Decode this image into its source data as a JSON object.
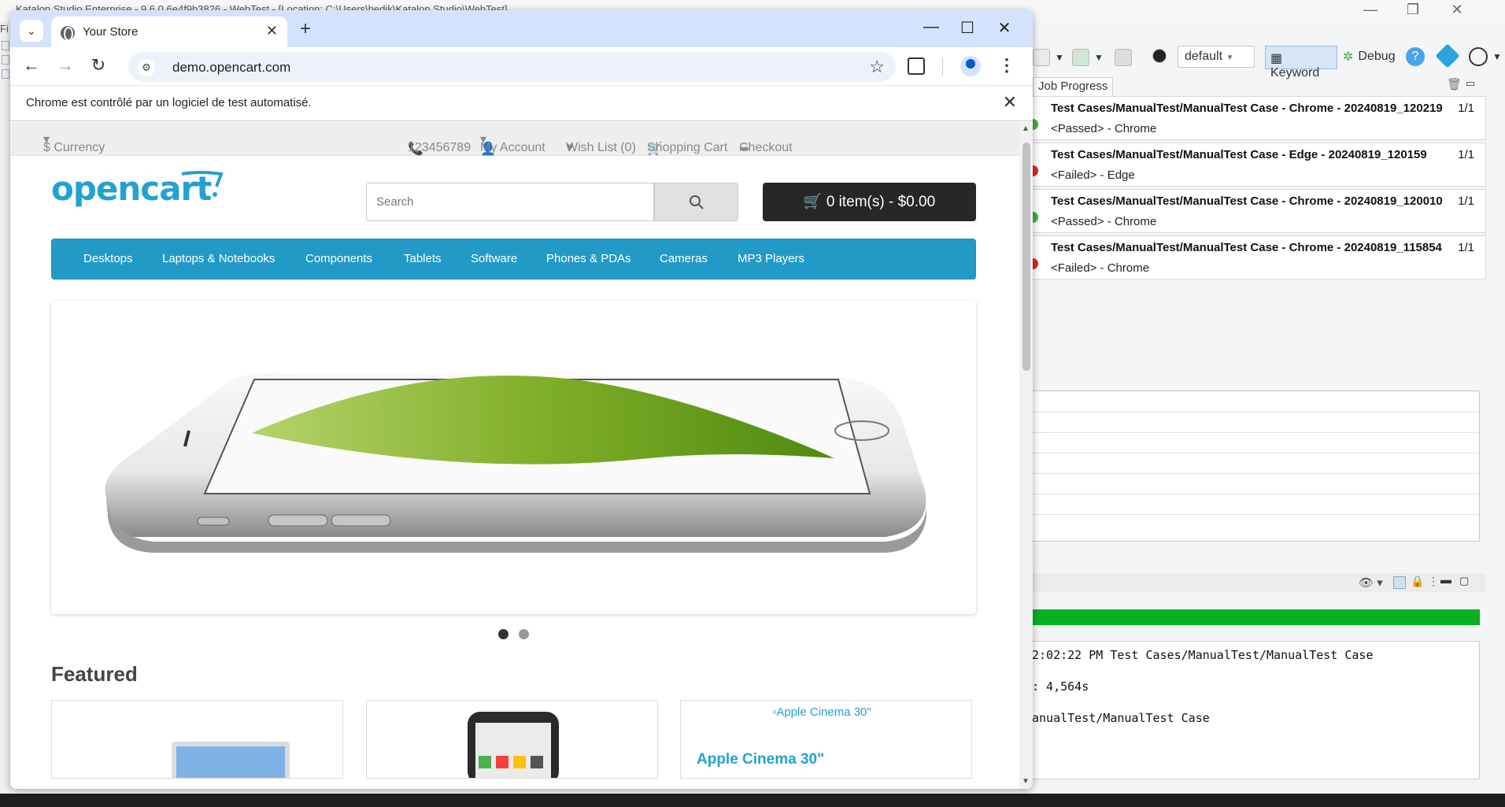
{
  "katalon": {
    "title": "Katalon Studio Enterprise - 9.6.0 6e4f9b3826 - WebTest - [Location: C:\\Users\\bedik\\Katalon Studio\\WebTest]",
    "menu_fragment": "Fi",
    "toolbar": {
      "profile": "default",
      "keyword_label": "Keyword",
      "debug_label": "Debug"
    },
    "job_progress_tab": "Job Progress",
    "jobs": [
      {
        "title": "Test Cases/ManualTest/ManualTest Case - Chrome - 20240819_120219",
        "count": "1/1",
        "status": "<Passed> - Chrome",
        "color": "#3bb33b"
      },
      {
        "title": "Test Cases/ManualTest/ManualTest Case - Edge - 20240819_120159",
        "count": "1/1",
        "status": "<Failed> - Edge",
        "color": "#e02424"
      },
      {
        "title": "Test Cases/ManualTest/ManualTest Case - Chrome - 20240819_120010",
        "count": "1/1",
        "status": "<Passed> - Chrome",
        "color": "#3bb33b"
      },
      {
        "title": "Test Cases/ManualTest/ManualTest Case - Chrome - 20240819_115854",
        "count": "1/1",
        "status": "<Failed> - Chrome",
        "color": "#e02424"
      }
    ],
    "progress": 1.0,
    "console_lines": [
      "2:02:22 PM Test Cases/ManualTest/ManualTest Case",
      ": 4,564s",
      "anualTest/ManualTest Case"
    ]
  },
  "chrome": {
    "tab_title": "Your Store",
    "url": "demo.opencart.com",
    "infobar_text": "Chrome est contrôlé par un logiciel de test automatisé."
  },
  "store": {
    "currency": "$ Currency",
    "phone": "123456789",
    "my_account": "My Account",
    "wishlist": "Wish List (0)",
    "shopping_cart": "Shopping Cart",
    "checkout": "Checkout",
    "logo": "opencart",
    "search_placeholder": "Search",
    "cart_button": "0 item(s) - $0.00",
    "menu": [
      "Desktops",
      "Laptops & Notebooks",
      "Components",
      "Tablets",
      "Software",
      "Phones & PDAs",
      "Cameras",
      "MP3 Players"
    ],
    "featured_heading": "Featured",
    "products": [
      {
        "name": ""
      },
      {
        "name": ""
      },
      {
        "image_alt": "Apple Cinema 30\"",
        "name": "Apple Cinema 30\""
      }
    ],
    "colors": {
      "brand": "#23a1d1",
      "menu": "#229ac8",
      "cart_bg": "#272727"
    }
  }
}
